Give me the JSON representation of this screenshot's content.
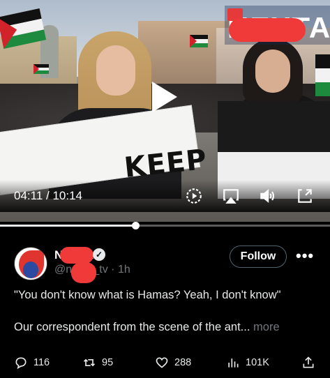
{
  "video": {
    "current_time": "04:11",
    "separator": " / ",
    "duration": "10:14",
    "progress_fraction": 0.41,
    "sign_text": "KEEP",
    "logo_text": "NEXTA",
    "icons": [
      "play-icon",
      "playback-speed-icon",
      "airplay-icon",
      "volume-icon",
      "fullscreen-exit-icon"
    ]
  },
  "post": {
    "author_name": "NEXTA",
    "handle": "@nexta_tv · 1h",
    "follow_label": "Follow",
    "more_label": "•••",
    "quote": "\"You don't know what is Hamas? Yeah, I don't know\"",
    "description": "Our correspondent from the scene of the ant...",
    "more_link": " more"
  },
  "actions": {
    "replies": "116",
    "reposts": "95",
    "likes": "288",
    "views": "101K"
  },
  "colors": {
    "background": "#000000",
    "text": "#e7e9ea",
    "muted": "#71767b",
    "redaction": "#f03a3a"
  }
}
